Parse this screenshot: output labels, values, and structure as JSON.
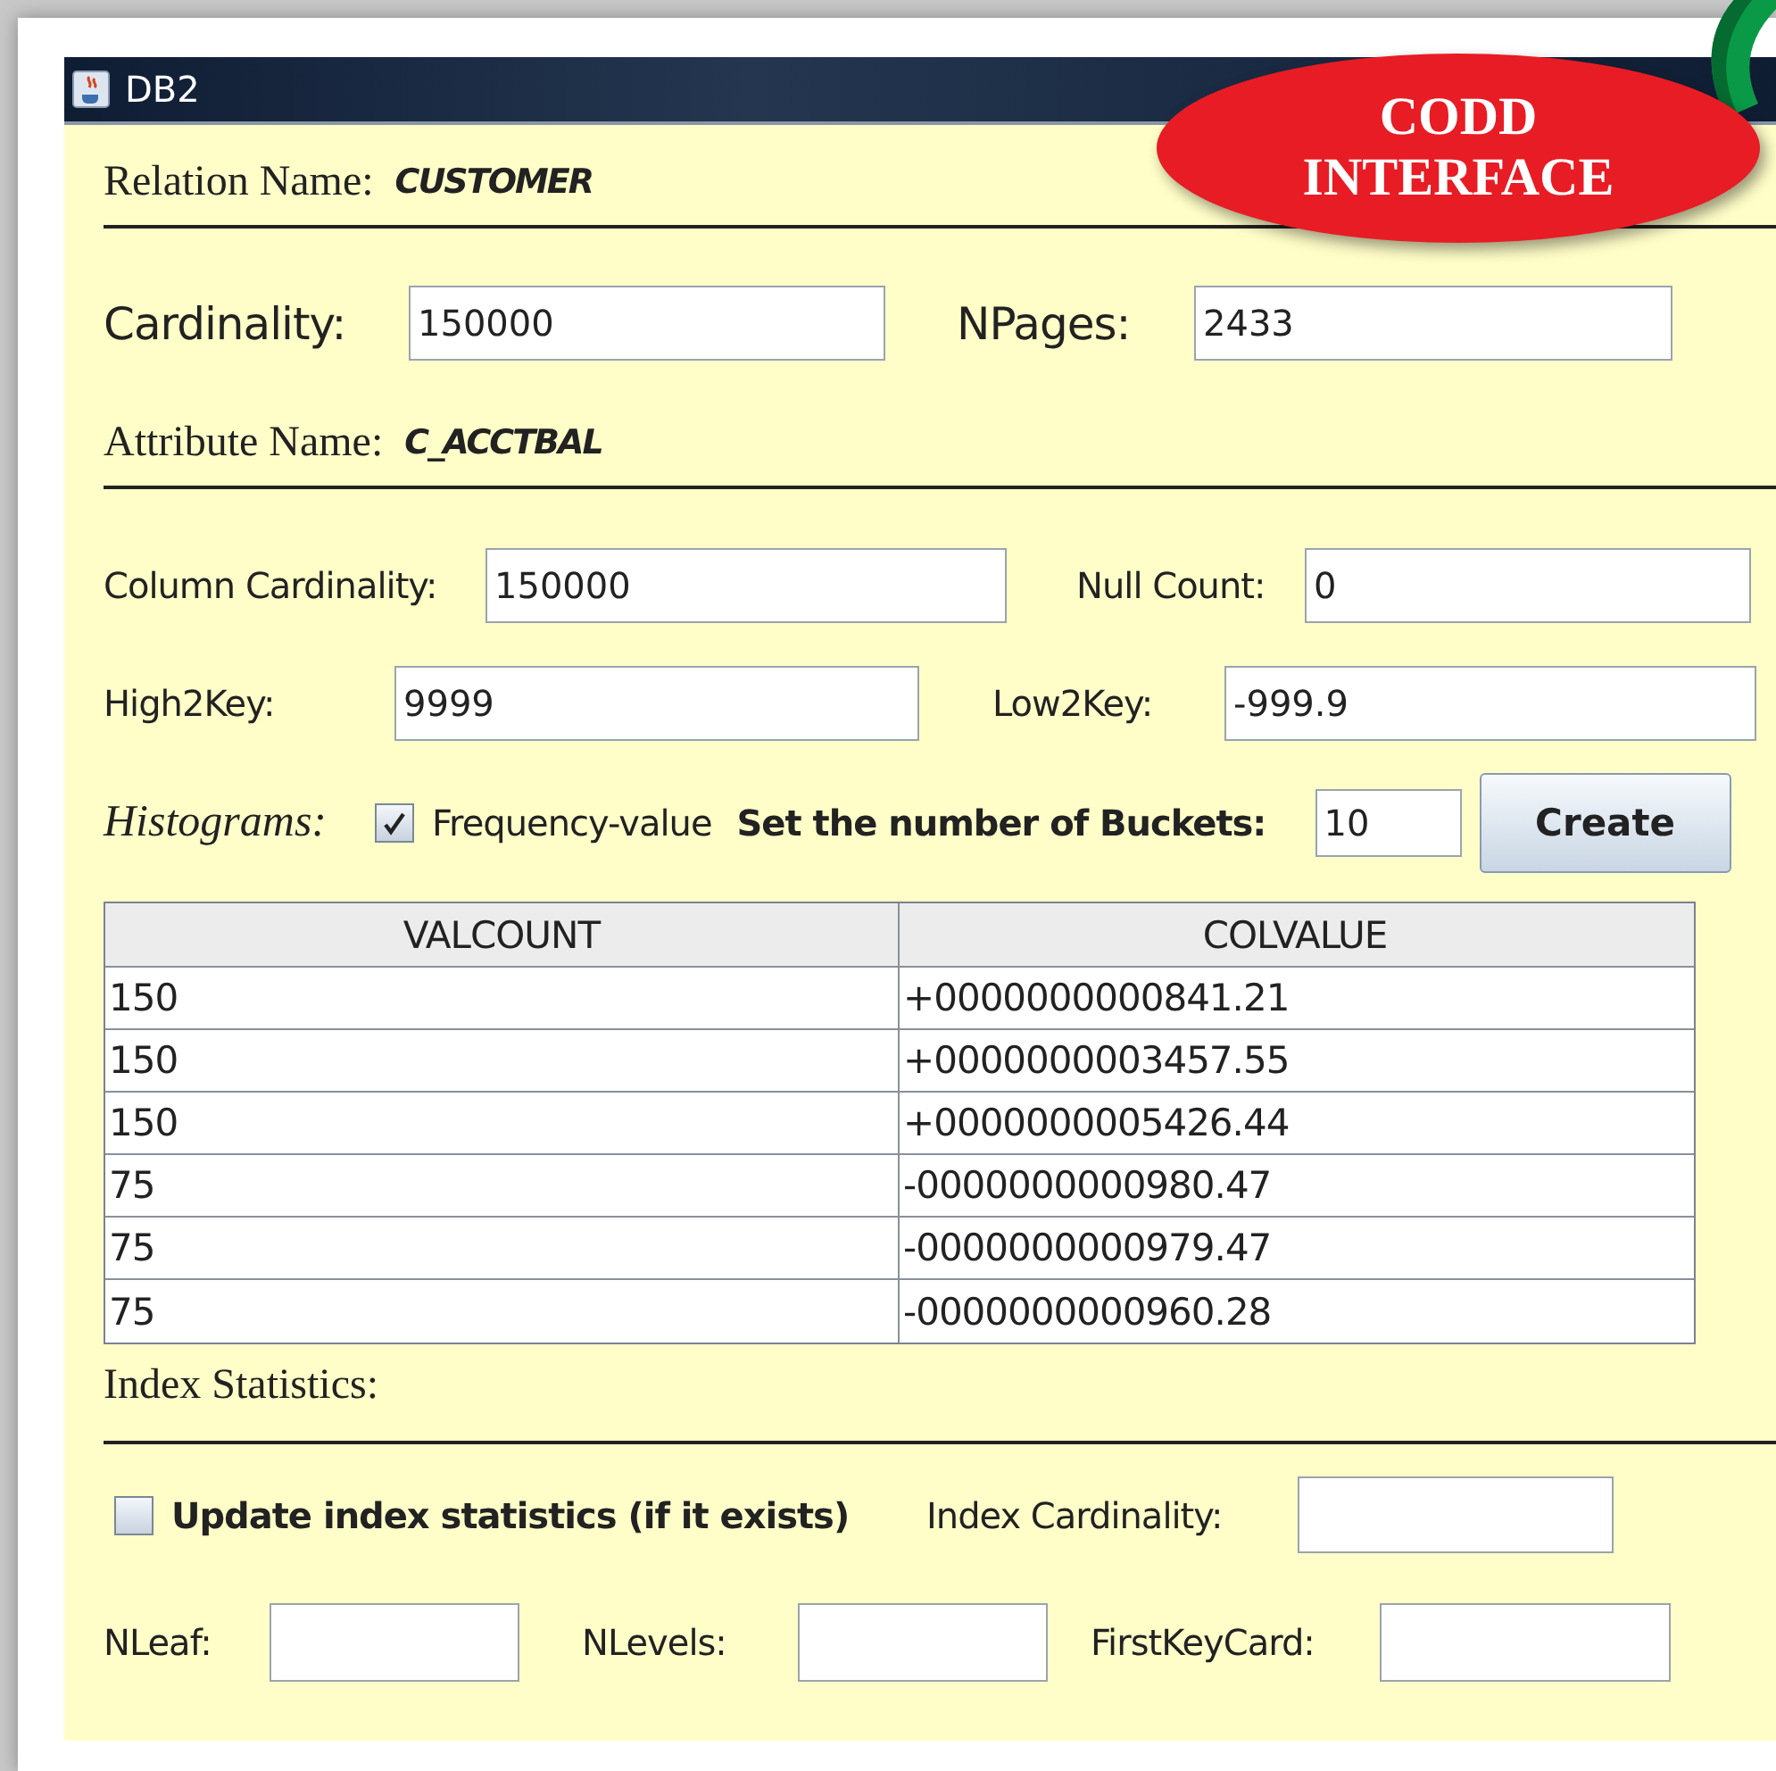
{
  "window": {
    "title": "DB2"
  },
  "badge": {
    "lines": [
      "CODD",
      "INTERFACE"
    ]
  },
  "relation": {
    "label": "Relation Name:",
    "value": "CUSTOMER"
  },
  "cardinality": {
    "label": "Cardinality:",
    "value": "150000"
  },
  "npages": {
    "label": "NPages:",
    "value": "2433"
  },
  "attribute": {
    "label": "Attribute Name:",
    "value": "C_ACCTBAL"
  },
  "column_cardinality": {
    "label": "Column Cardinality:",
    "value": "150000"
  },
  "null_count": {
    "label": "Null Count:",
    "value": "0"
  },
  "high2key": {
    "label": "High2Key:",
    "value": "9999"
  },
  "low2key": {
    "label": "Low2Key:",
    "value": "-999.9"
  },
  "histograms": {
    "label": "Histograms:",
    "frequency": {
      "label": "Frequency-value",
      "checked": true
    },
    "buckets_label": "Set the number of Buckets:",
    "buckets": "10",
    "button": "Create"
  },
  "table": {
    "columns": [
      "VALCOUNT",
      "COLVALUE"
    ],
    "rows": [
      [
        "150",
        "+0000000000841.21"
      ],
      [
        "150",
        "+0000000003457.55"
      ],
      [
        "150",
        "+0000000005426.44"
      ],
      [
        "75",
        "-0000000000980.47"
      ],
      [
        "75",
        "-0000000000979.47"
      ],
      [
        "75",
        "-0000000000960.28"
      ]
    ]
  },
  "index": {
    "label": "Index Statistics:",
    "update": {
      "label": "Update index statistics (if it exists)",
      "checked": false
    },
    "index_cardinality": {
      "label": "Index Cardinality:"
    },
    "nleaf": {
      "label": "NLeaf:"
    },
    "nlevels": {
      "label": "NLevels:"
    },
    "firstkeycard": {
      "label": "FirstKeyCard:"
    }
  }
}
